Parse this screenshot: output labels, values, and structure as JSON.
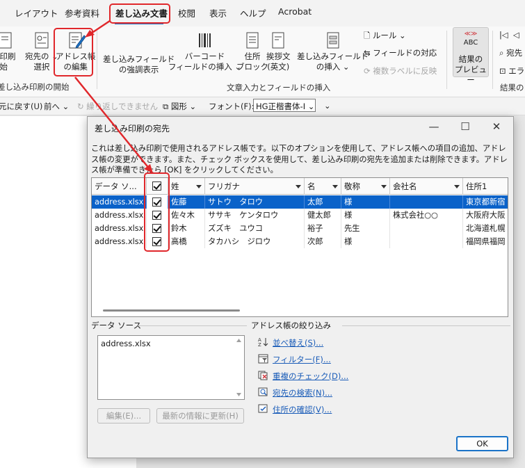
{
  "ribbon_tabs": [
    "レイアウト",
    "参考資料",
    "差し込み文書",
    "校閲",
    "表示",
    "ヘルプ",
    "Acrobat"
  ],
  "ribbon": {
    "start_merge_partial": "み印刷",
    "start_merge_partial2": "始",
    "select_recipients_l1": "宛先の",
    "select_recipients_l2": "選択",
    "edit_list_l1": "アドレス帳",
    "edit_list_l2": "の編集",
    "group_start": "差し込み印刷の開始",
    "highlight_fields_l1": "差し込みフィールド",
    "highlight_fields_l2": "の強調表示",
    "barcode_l1": "バーコード",
    "barcode_l2": "フィールドの挿入",
    "address_block_l1": "住所",
    "address_block_l2": "ブロック",
    "greeting_l1": "挨拶文",
    "greeting_l2": "(英文)",
    "insert_field_l1": "差し込みフィールド",
    "insert_field_l2": "の挿入",
    "rules": "ルール",
    "match_fields": "フィールドの対応",
    "update_labels": "複数ラベルに反映",
    "group_write": "文章入力とフィールドの挿入",
    "preview_abc": "ABC",
    "preview_l1": "結果の",
    "preview_l2": "プレビュー",
    "group_preview_partial": "結果の",
    "right_partial1": "宛先",
    "right_partial2": "エラ"
  },
  "quickbar": {
    "undo": "元に戻す(U)",
    "prev": "前へ",
    "redo": "繰り返しできません",
    "shapes": "図形",
    "font_label": "フォント(F):",
    "font_value": "HG正楷書体-I"
  },
  "dialog": {
    "title": "差し込み印刷の宛先",
    "description": "これは差し込み印刷で使用されるアドレス帳です。以下のオプションを使用して、アドレス帳への項目の追加、アドレス帳の変更ができます。また、チェック ボックスを使用して、差し込み印刷の宛先を追加または削除できます。アドレス帳が準備できたら [OK] をクリックしてください。",
    "columns": [
      "データ ソ...",
      "",
      "姓",
      "フリガナ",
      "名",
      "敬称",
      "会社名",
      "住所1"
    ],
    "rows": [
      {
        "source": "address.xlsx",
        "last": "佐藤",
        "kana": "サトウ　タロウ",
        "first": "太郎",
        "honorific": "様",
        "company": "",
        "address": "東京都新宿"
      },
      {
        "source": "address.xlsx",
        "last": "佐々木",
        "kana": "ササキ　ケンタロウ",
        "first": "健太郎",
        "honorific": "様",
        "company": "株式会社○○",
        "address": "大阪府大阪"
      },
      {
        "source": "address.xlsx",
        "last": "鈴木",
        "kana": "ズズキ　ユウコ",
        "first": "裕子",
        "honorific": "先生",
        "company": "",
        "address": "北海道札幌"
      },
      {
        "source": "address.xlsx",
        "last": "高橋",
        "kana": "タカハシ　ジロウ",
        "first": "次郎",
        "honorific": "様",
        "company": "",
        "address": "福岡県福岡"
      }
    ],
    "data_source_label": "データ ソース",
    "data_source_item": "address.xlsx",
    "edit_button": "編集(E)...",
    "refresh_button": "最新の情報に更新(H)",
    "refine_label": "アドレス帳の絞り込み",
    "links": [
      "並べ替え(S)...",
      "フィルター(F)...",
      "重複のチェック(D)...",
      "宛先の検索(N)...",
      "住所の確認(V)..."
    ],
    "ok_button": "OK"
  },
  "colors": {
    "accent": "#1a73c8",
    "selection": "#0a62c9",
    "highlight": "#e0272b"
  }
}
